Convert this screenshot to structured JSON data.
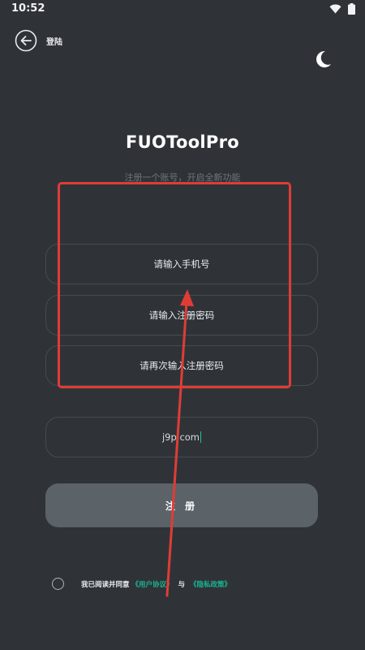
{
  "status_bar": {
    "time": "10:52"
  },
  "header": {
    "back_label": "登陆"
  },
  "app": {
    "title": "FUOToolPro",
    "subtitle": "注册一个账号，开启全新功能"
  },
  "form": {
    "phone_placeholder": "请输入手机号",
    "password_placeholder": "请输入注册密码",
    "confirm_placeholder": "请再次输入注册密码",
    "code_value": "j9p.com"
  },
  "register_button_label": "注 册",
  "agreement": {
    "prefix": "我已阅读并同意",
    "user_agreement": "《用户协议》",
    "conjunction": "与",
    "privacy_policy": "《隐私政策》"
  },
  "colors": {
    "background": "#2f3338",
    "accent": "#19b38f",
    "annotation": "#e03c36",
    "button": "#5b6268"
  },
  "icons": [
    "wifi-icon",
    "battery-icon",
    "back-arrow-icon",
    "moon-icon",
    "checkbox-circle-icon"
  ]
}
